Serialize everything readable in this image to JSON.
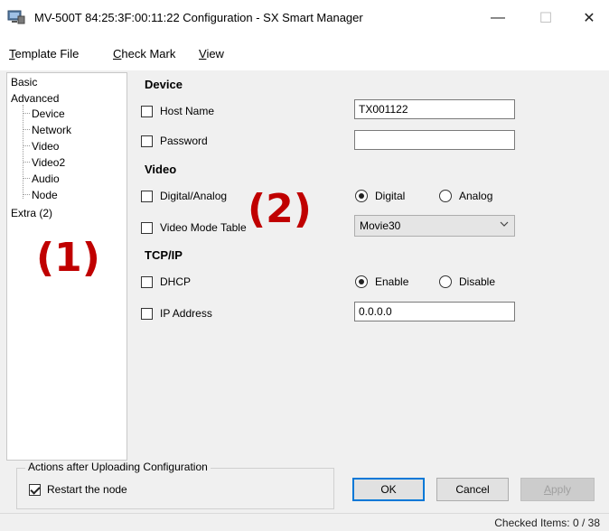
{
  "window": {
    "title": "MV-500T 84:25:3F:00:11:22  Configuration - SX Smart Manager",
    "minimize_glyph": "—",
    "maximize_glyph": "☐",
    "close_glyph": "✕"
  },
  "menu": {
    "template_file": {
      "u": "T",
      "rest": "emplate File"
    },
    "check_mark": {
      "u": "C",
      "rest": "heck Mark"
    },
    "view": {
      "u": "V",
      "rest": "iew"
    }
  },
  "tree": {
    "basic": "Basic",
    "advanced": "Advanced",
    "device": "Device",
    "network": "Network",
    "video": "Video",
    "video2": "Video2",
    "audio": "Audio",
    "node": "Node",
    "extra": "Extra (2)"
  },
  "annotations": {
    "one": "(1)",
    "two": "(2)"
  },
  "device": {
    "heading": "Device",
    "host_name_label": "Host Name",
    "host_name_value": "TX001122",
    "password_label": "Password",
    "password_value": ""
  },
  "video": {
    "heading": "Video",
    "digital_analog_label": "Digital/Analog",
    "digital_option": "Digital",
    "analog_option": "Analog",
    "mode_table_label": "Video Mode Table",
    "mode_table_value": "Movie30"
  },
  "tcpip": {
    "heading": "TCP/IP",
    "dhcp_label": "DHCP",
    "enable_option": "Enable",
    "disable_option": "Disable",
    "ip_label": "IP Address",
    "ip_value": "0.0.0.0"
  },
  "actions": {
    "group_title": "Actions after Uploading Configuration",
    "restart_label": "Restart the node"
  },
  "buttons": {
    "ok": "OK",
    "cancel": "Cancel",
    "apply": {
      "u": "A",
      "rest": "pply"
    }
  },
  "status": {
    "checked_items": "Checked Items: 0 / 38"
  }
}
